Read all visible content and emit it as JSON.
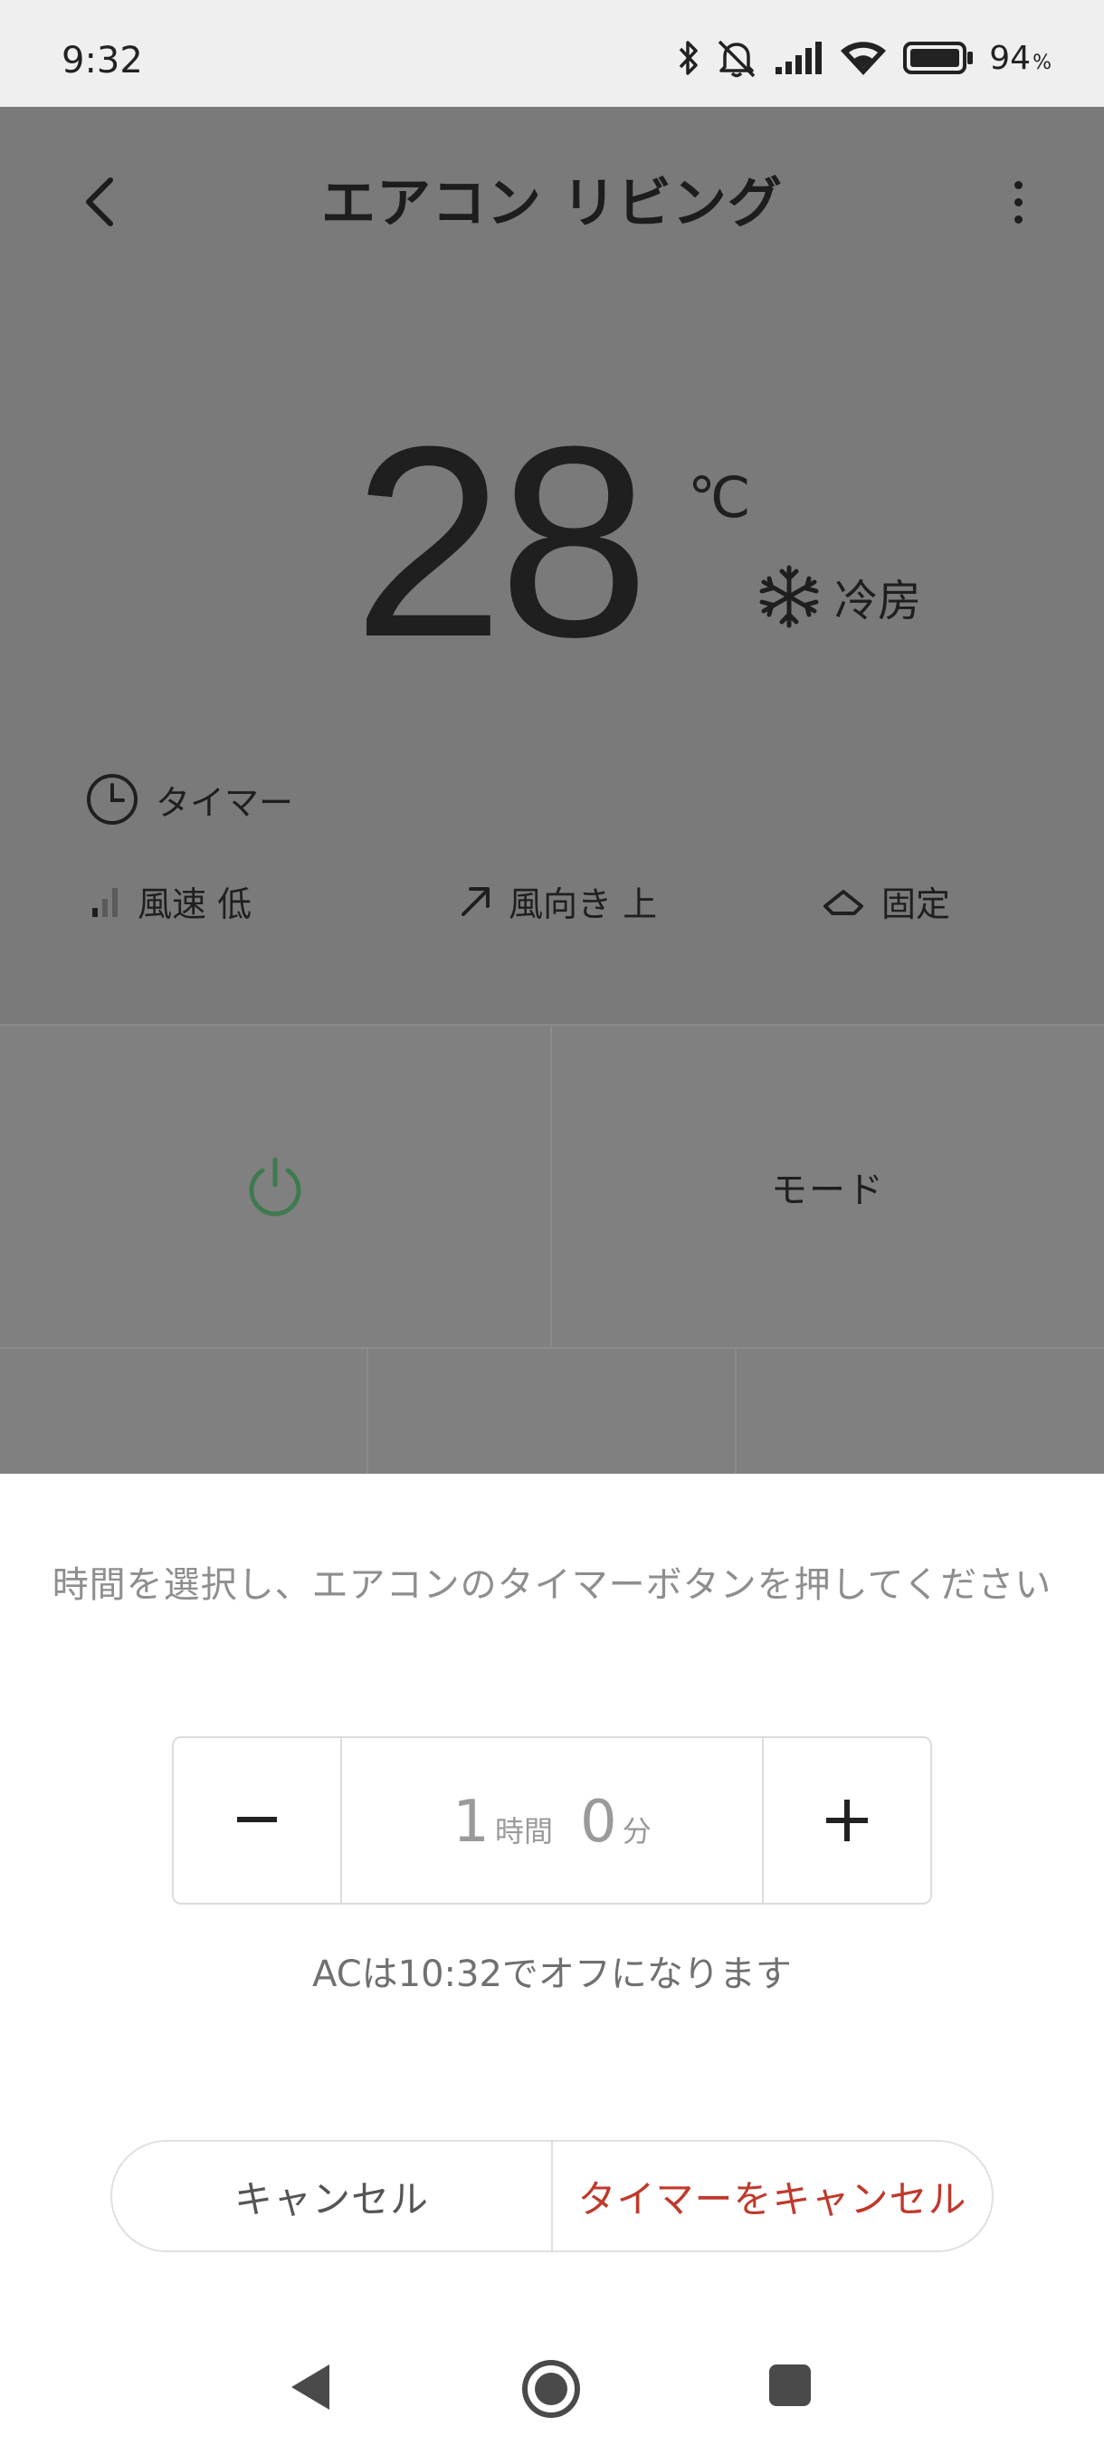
{
  "status_bar": {
    "time": "9:32",
    "battery_percent": "94",
    "battery_unit": "%",
    "icons": [
      "bluetooth-icon",
      "mute-icon",
      "signal-icon",
      "wifi-icon",
      "battery-icon"
    ]
  },
  "header": {
    "title": "エアコン リビング",
    "back_icon": "chevron-left-icon",
    "menu_icon": "more-vertical-icon"
  },
  "climate": {
    "temperature": "28",
    "unit": "℃",
    "mode_icon": "snowflake-icon",
    "mode": "冷房"
  },
  "timer": {
    "icon": "clock-icon",
    "label": "タイマー"
  },
  "info": {
    "fan_speed": "風速 低",
    "wind_direction": "風向き 上",
    "swing": "固定"
  },
  "controls": {
    "power_icon": "power-icon",
    "mode_label": "モード"
  },
  "sheet": {
    "instruction": "時間を選択し、エアコンのタイマーボタンを押してください",
    "hours": "1",
    "hours_unit": "時間",
    "minutes": "0",
    "minutes_unit": "分",
    "off_note": "ACは10:32でオフになります",
    "cancel_label": "キャンセル",
    "cancel_timer_label": "タイマーをキャンセル"
  },
  "colors": {
    "accent_red": "#c0392b",
    "power_green": "#3f7a4f",
    "dim_overlay": "#7a7a7a"
  }
}
